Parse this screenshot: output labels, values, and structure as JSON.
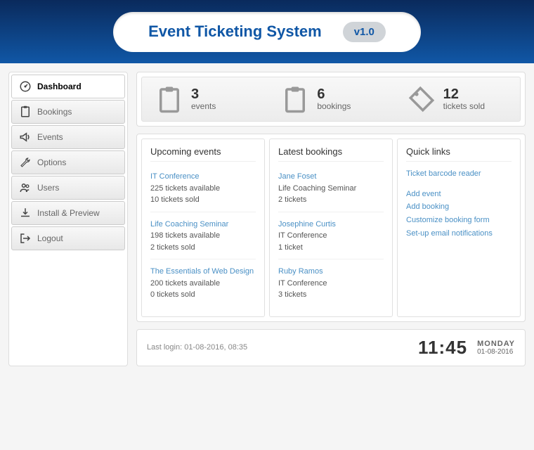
{
  "header": {
    "title": "Event Ticketing System",
    "version": "v1.0"
  },
  "sidebar": {
    "items": [
      {
        "label": "Dashboard",
        "active": true
      },
      {
        "label": "Bookings"
      },
      {
        "label": "Events"
      },
      {
        "label": "Options"
      },
      {
        "label": "Users"
      },
      {
        "label": "Install & Preview"
      },
      {
        "label": "Logout"
      }
    ]
  },
  "stats": {
    "events": {
      "count": "3",
      "label": "events"
    },
    "bookings": {
      "count": "6",
      "label": "bookings"
    },
    "tickets": {
      "count": "12",
      "label": "tickets sold"
    }
  },
  "upcoming": {
    "title": "Upcoming events",
    "items": [
      {
        "name": "IT Conference",
        "available": "225 tickets available",
        "sold": "10 tickets sold"
      },
      {
        "name": "Life Coaching Seminar",
        "available": "198 tickets available",
        "sold": "2 tickets sold"
      },
      {
        "name": "The Essentials of Web Design",
        "available": "200 tickets available",
        "sold": "0 tickets sold"
      }
    ]
  },
  "latest": {
    "title": "Latest bookings",
    "items": [
      {
        "name": "Jane Foset",
        "event": "Life Coaching Seminar",
        "tickets": "2 tickets"
      },
      {
        "name": "Josephine Curtis",
        "event": "IT Conference",
        "tickets": "1 ticket"
      },
      {
        "name": "Ruby Ramos",
        "event": "IT Conference",
        "tickets": "3 tickets"
      }
    ]
  },
  "quicklinks": {
    "title": "Quick links",
    "items": [
      "Ticket barcode reader",
      "Add event",
      "Add booking",
      "Customize booking form",
      "Set-up email notifications"
    ]
  },
  "footer": {
    "last_login": "Last login: 01-08-2016, 08:35",
    "time": "11:45",
    "day": "MONDAY",
    "date": "01-08-2016"
  }
}
